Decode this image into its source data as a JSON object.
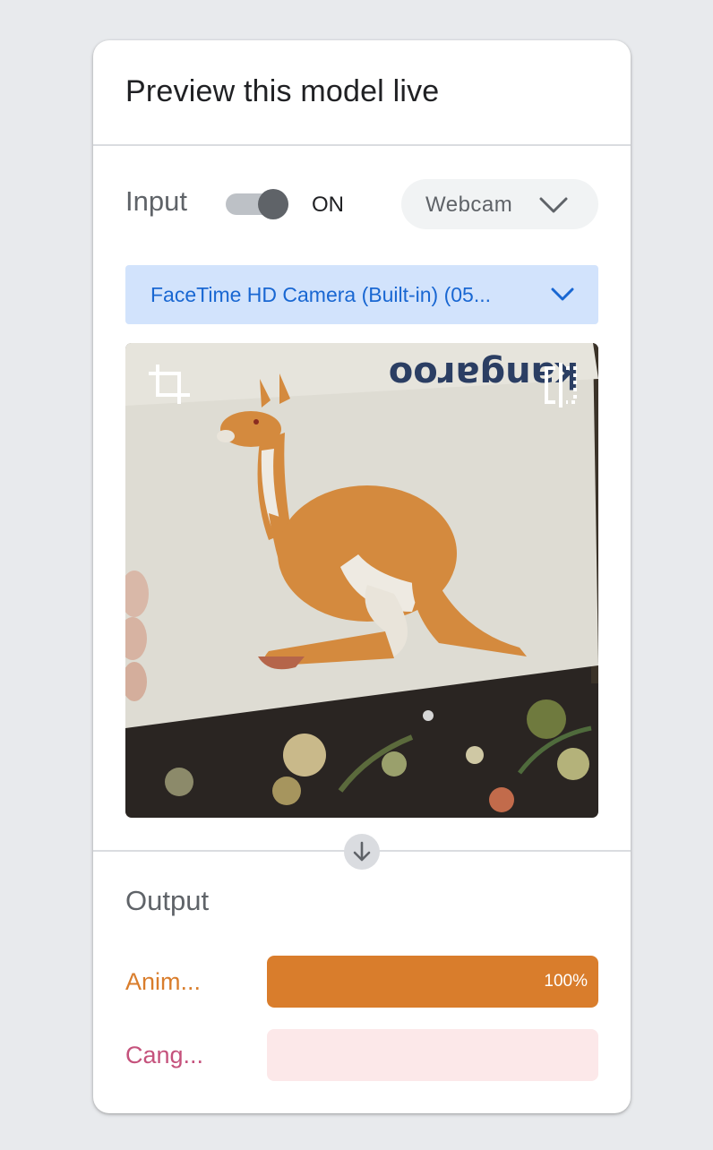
{
  "panel": {
    "title": "Preview this model live"
  },
  "input": {
    "label": "Input",
    "toggle_state": "ON",
    "toggle_on": true,
    "source": "Webcam",
    "camera": "FaceTime HD Camera (Built-in) (05...",
    "webcam_card_text": "kangaroo"
  },
  "output": {
    "label": "Output",
    "classes": [
      {
        "label": "Anim...",
        "confidence": 1.0,
        "confidence_label": "100%",
        "color": "#d97d2c",
        "track_color": "#fbe6d3"
      },
      {
        "label": "Cang...",
        "confidence": 0.0,
        "confidence_label": "",
        "color": "#c5527c",
        "track_color": "#fce8e9"
      }
    ]
  },
  "icons": {
    "crop": "crop-icon",
    "flip": "flip-icon",
    "source_dropdown": "chevron-down-icon",
    "camera_dropdown": "chevron-down-icon",
    "flow": "arrow-down-icon"
  },
  "colors": {
    "background": "#e8eaed",
    "camera_select_bg": "#d2e3fc",
    "camera_select_text": "#1967d2",
    "toggle_thumb": "#5f6368"
  }
}
